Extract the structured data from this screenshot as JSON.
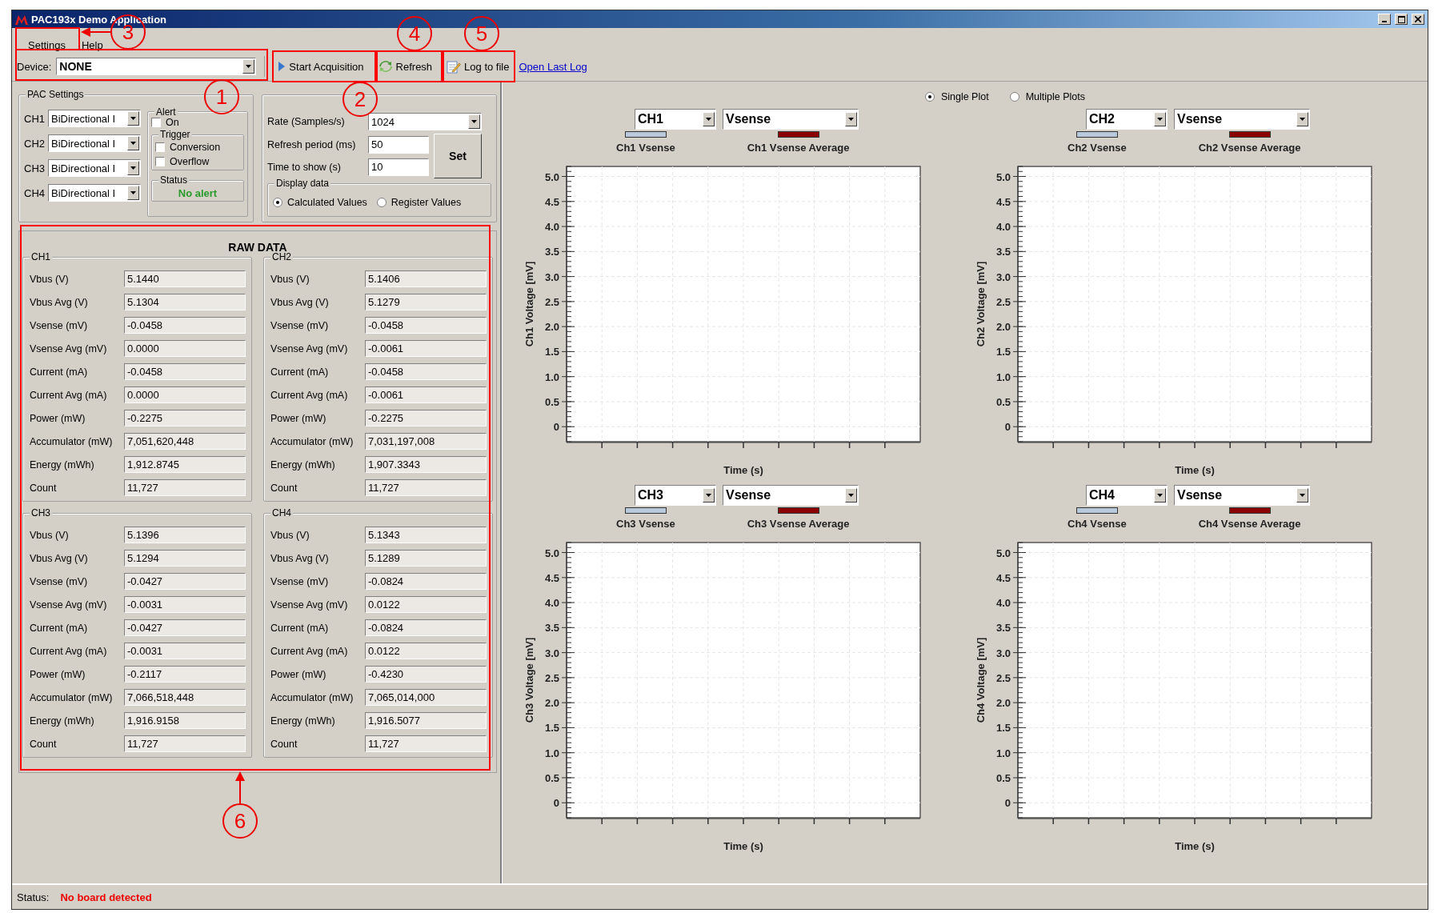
{
  "window": {
    "title": "PAC193x Demo Application"
  },
  "menu": [
    {
      "label": "Settings"
    },
    {
      "label": "Help"
    }
  ],
  "toolbar": {
    "device_label": "Device:",
    "device_value": "NONE",
    "buttons": [
      {
        "label": "Start Acquisition",
        "kind": "play"
      },
      {
        "label": "Refresh",
        "kind": "refresh"
      },
      {
        "label": "Log to file",
        "kind": "log"
      }
    ],
    "link": "Open Last Log"
  },
  "pac_settings": {
    "title": "PAC Settings",
    "channels": [
      {
        "label": "CH1",
        "mode": "BiDirectional I"
      },
      {
        "label": "CH2",
        "mode": "BiDirectional I"
      },
      {
        "label": "CH3",
        "mode": "BiDirectional I"
      },
      {
        "label": "CH4",
        "mode": "BiDirectional I"
      }
    ],
    "alert": {
      "title": "Alert",
      "on_label": "On",
      "on": false,
      "trigger_title": "Trigger",
      "triggers": [
        {
          "label": "Conversion",
          "checked": false
        },
        {
          "label": "Overflow",
          "checked": false
        }
      ],
      "status_title": "Status",
      "status": "No alert"
    }
  },
  "acquisition": {
    "rate_label": "Rate (Samples/s)",
    "rate": "1024",
    "refresh_label": "Refresh period (ms)",
    "refresh": "50",
    "time_label": "Time to show (s)",
    "time": "10",
    "set_button": "Set",
    "display_title": "Display data",
    "display_options": [
      {
        "label": "Calculated Values",
        "selected": true
      },
      {
        "label": "Register Values",
        "selected": false
      }
    ]
  },
  "raw_data": {
    "title": "RAW DATA",
    "channels": [
      {
        "name": "CH1",
        "fields": [
          {
            "label": "Vbus (V)",
            "value": "5.1440"
          },
          {
            "label": "Vbus Avg (V)",
            "value": "5.1304"
          },
          {
            "label": "Vsense (mV)",
            "value": "-0.0458"
          },
          {
            "label": "Vsense Avg (mV)",
            "value": "0.0000"
          },
          {
            "label": "Current (mA)",
            "value": "-0.0458"
          },
          {
            "label": "Current Avg (mA)",
            "value": "0.0000"
          },
          {
            "label": "Power (mW)",
            "value": "-0.2275"
          },
          {
            "label": "Accumulator (mW)",
            "value": "7,051,620,448"
          },
          {
            "label": "Energy (mWh)",
            "value": "1,912.8745"
          },
          {
            "label": "Count",
            "value": "11,727"
          }
        ]
      },
      {
        "name": "CH2",
        "fields": [
          {
            "label": "Vbus (V)",
            "value": "5.1406"
          },
          {
            "label": "Vbus Avg (V)",
            "value": "5.1279"
          },
          {
            "label": "Vsense (mV)",
            "value": "-0.0458"
          },
          {
            "label": "Vsense Avg (mV)",
            "value": "-0.0061"
          },
          {
            "label": "Current (mA)",
            "value": "-0.0458"
          },
          {
            "label": "Current Avg (mA)",
            "value": "-0.0061"
          },
          {
            "label": "Power (mW)",
            "value": "-0.2275"
          },
          {
            "label": "Accumulator (mW)",
            "value": "7,031,197,008"
          },
          {
            "label": "Energy (mWh)",
            "value": "1,907.3343"
          },
          {
            "label": "Count",
            "value": "11,727"
          }
        ]
      },
      {
        "name": "CH3",
        "fields": [
          {
            "label": "Vbus (V)",
            "value": "5.1396"
          },
          {
            "label": "Vbus Avg (V)",
            "value": "5.1294"
          },
          {
            "label": "Vsense (mV)",
            "value": "-0.0427"
          },
          {
            "label": "Vsense Avg (mV)",
            "value": "-0.0031"
          },
          {
            "label": "Current (mA)",
            "value": "-0.0427"
          },
          {
            "label": "Current Avg (mA)",
            "value": "-0.0031"
          },
          {
            "label": "Power (mW)",
            "value": "-0.2117"
          },
          {
            "label": "Accumulator (mW)",
            "value": "7,066,518,448"
          },
          {
            "label": "Energy (mWh)",
            "value": "1,916.9158"
          },
          {
            "label": "Count",
            "value": "11,727"
          }
        ]
      },
      {
        "name": "CH4",
        "fields": [
          {
            "label": "Vbus (V)",
            "value": "5.1343"
          },
          {
            "label": "Vbus Avg (V)",
            "value": "5.1289"
          },
          {
            "label": "Vsense (mV)",
            "value": "-0.0824"
          },
          {
            "label": "Vsense Avg (mV)",
            "value": "0.0122"
          },
          {
            "label": "Current (mA)",
            "value": "-0.0824"
          },
          {
            "label": "Current Avg (mA)",
            "value": "0.0122"
          },
          {
            "label": "Power (mW)",
            "value": "-0.4230"
          },
          {
            "label": "Accumulator (mW)",
            "value": "7,065,014,000"
          },
          {
            "label": "Energy (mWh)",
            "value": "1,916.5077"
          },
          {
            "label": "Count",
            "value": "11,727"
          }
        ]
      }
    ]
  },
  "plot_mode": [
    {
      "label": "Single Plot",
      "selected": true
    },
    {
      "label": "Multiple Plots",
      "selected": false
    }
  ],
  "plots": [
    {
      "channel": "CH1",
      "quantity": "Vsense",
      "chart_data": {
        "type": "line",
        "ylim": [
          -0.3,
          5.2
        ],
        "grid": true,
        "xlabel": "Time (s)",
        "ylabel": "Ch1 Voltage [mV]",
        "yticks": [
          {
            "value": 0,
            "label": "0"
          },
          {
            "value": 0.5,
            "label": "0.5"
          },
          {
            "value": 1,
            "label": "1.0"
          },
          {
            "value": 1.5,
            "label": "1.5"
          },
          {
            "value": 2,
            "label": "2.0"
          },
          {
            "value": 2.5,
            "label": "2.5"
          },
          {
            "value": 3,
            "label": "3.0"
          },
          {
            "value": 3.5,
            "label": "3.5"
          },
          {
            "value": 4,
            "label": "4.0"
          },
          {
            "value": 4.5,
            "label": "4.5"
          },
          {
            "value": 5,
            "label": "5.0"
          }
        ],
        "series": [
          {
            "name": "Ch1 Vsense",
            "color": "#b9c9dc"
          },
          {
            "name": "Ch1 Vsense Average",
            "color": "#8b0000"
          }
        ]
      }
    },
    {
      "channel": "CH2",
      "quantity": "Vsense",
      "chart_data": {
        "type": "line",
        "ylim": [
          -0.3,
          5.2
        ],
        "grid": true,
        "xlabel": "Time (s)",
        "ylabel": "Ch2 Voltage [mV]",
        "yticks": [
          {
            "value": 0,
            "label": "0"
          },
          {
            "value": 0.5,
            "label": "0.5"
          },
          {
            "value": 1,
            "label": "1.0"
          },
          {
            "value": 1.5,
            "label": "1.5"
          },
          {
            "value": 2,
            "label": "2.0"
          },
          {
            "value": 2.5,
            "label": "2.5"
          },
          {
            "value": 3,
            "label": "3.0"
          },
          {
            "value": 3.5,
            "label": "3.5"
          },
          {
            "value": 4,
            "label": "4.0"
          },
          {
            "value": 4.5,
            "label": "4.5"
          },
          {
            "value": 5,
            "label": "5.0"
          }
        ],
        "series": [
          {
            "name": "Ch2 Vsense",
            "color": "#b9c9dc"
          },
          {
            "name": "Ch2 Vsense Average",
            "color": "#8b0000"
          }
        ]
      }
    },
    {
      "channel": "CH3",
      "quantity": "Vsense",
      "chart_data": {
        "type": "line",
        "ylim": [
          -0.3,
          5.2
        ],
        "grid": true,
        "xlabel": "Time (s)",
        "ylabel": "Ch3 Voltage [mV]",
        "yticks": [
          {
            "value": 0,
            "label": "0"
          },
          {
            "value": 0.5,
            "label": "0.5"
          },
          {
            "value": 1,
            "label": "1.0"
          },
          {
            "value": 1.5,
            "label": "1.5"
          },
          {
            "value": 2,
            "label": "2.0"
          },
          {
            "value": 2.5,
            "label": "2.5"
          },
          {
            "value": 3,
            "label": "3.0"
          },
          {
            "value": 3.5,
            "label": "3.5"
          },
          {
            "value": 4,
            "label": "4.0"
          },
          {
            "value": 4.5,
            "label": "4.5"
          },
          {
            "value": 5,
            "label": "5.0"
          }
        ],
        "series": [
          {
            "name": "Ch3 Vsense",
            "color": "#b9c9dc"
          },
          {
            "name": "Ch3 Vsense Average",
            "color": "#8b0000"
          }
        ]
      }
    },
    {
      "channel": "CH4",
      "quantity": "Vsense",
      "chart_data": {
        "type": "line",
        "ylim": [
          -0.3,
          5.2
        ],
        "grid": true,
        "xlabel": "Time (s)",
        "ylabel": "Ch4 Voltage [mV]",
        "yticks": [
          {
            "value": 0,
            "label": "0"
          },
          {
            "value": 0.5,
            "label": "0.5"
          },
          {
            "value": 1,
            "label": "1.0"
          },
          {
            "value": 1.5,
            "label": "1.5"
          },
          {
            "value": 2,
            "label": "2.0"
          },
          {
            "value": 2.5,
            "label": "2.5"
          },
          {
            "value": 3,
            "label": "3.0"
          },
          {
            "value": 3.5,
            "label": "3.5"
          },
          {
            "value": 4,
            "label": "4.0"
          },
          {
            "value": 4.5,
            "label": "4.5"
          },
          {
            "value": 5,
            "label": "5.0"
          }
        ],
        "series": [
          {
            "name": "Ch4 Vsense",
            "color": "#b9c9dc"
          },
          {
            "name": "Ch4 Vsense Average",
            "color": "#8b0000"
          }
        ]
      }
    }
  ],
  "status_bar": {
    "label": "Status:",
    "value": "No board detected"
  },
  "callouts": [
    {
      "label": "1"
    },
    {
      "label": "2"
    },
    {
      "label": "3"
    },
    {
      "label": "4"
    },
    {
      "label": "5"
    },
    {
      "label": "6"
    }
  ]
}
